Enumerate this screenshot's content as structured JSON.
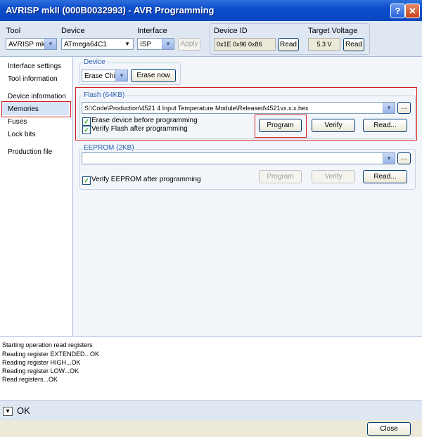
{
  "window": {
    "title": "AVRISP mkII (000B0032993) - AVR Programming",
    "help_symbol": "?",
    "close_symbol": "✕"
  },
  "toolbar": {
    "tool_label": "Tool",
    "tool_value": "AVRISP mkII",
    "device_label": "Device",
    "device_value": "ATmega64C1",
    "interface_label": "Interface",
    "interface_value": "ISP",
    "apply_label": "Apply",
    "device_id_label": "Device ID",
    "device_id_value": "0x1E 0x96 0x86",
    "read_label": "Read",
    "target_voltage_label": "Target Voltage",
    "target_voltage_value": "5.3 V",
    "voltage_read_label": "Read"
  },
  "sidebar": {
    "items": [
      {
        "label": "Interface settings"
      },
      {
        "label": "Tool information"
      },
      {
        "label": "Device information"
      },
      {
        "label": "Memories"
      },
      {
        "label": "Fuses"
      },
      {
        "label": "Lock bits"
      },
      {
        "label": "Production file"
      }
    ]
  },
  "device_group": {
    "title": "Device",
    "erase_value": "Erase Chip",
    "erase_now_label": "Erase now"
  },
  "flash_group": {
    "title": "Flash (64KB)",
    "path": "S:\\Code\\Production\\4521 4 Input Temperature Module\\Released\\4521vx.x.x.hex",
    "browse_label": "...",
    "erase_before_label": "Erase device before programming",
    "verify_after_label": "Verify Flash after programming",
    "program_label": "Program",
    "verify_label": "Verify",
    "read_label": "Read..."
  },
  "eeprom_group": {
    "title": "EEPROM (2KB)",
    "path": "",
    "browse_label": "...",
    "verify_after_label": "Verify EEPROM after programming",
    "program_label": "Program",
    "verify_label": "Verify",
    "read_label": "Read..."
  },
  "log": {
    "lines": [
      "Starting operation read registers",
      "Reading register EXTENDED...OK",
      "Reading register HIGH...OK",
      "Reading register LOW...OK",
      "Read registers...OK"
    ]
  },
  "status": {
    "text": "OK",
    "expand_symbol": "▾"
  },
  "footer": {
    "close_label": "Close"
  },
  "colors": {
    "title_bar": "#0b4dcb",
    "highlight_outline": "#d02020",
    "group_title": "#2a5db0",
    "check_mark": "#21a121"
  }
}
